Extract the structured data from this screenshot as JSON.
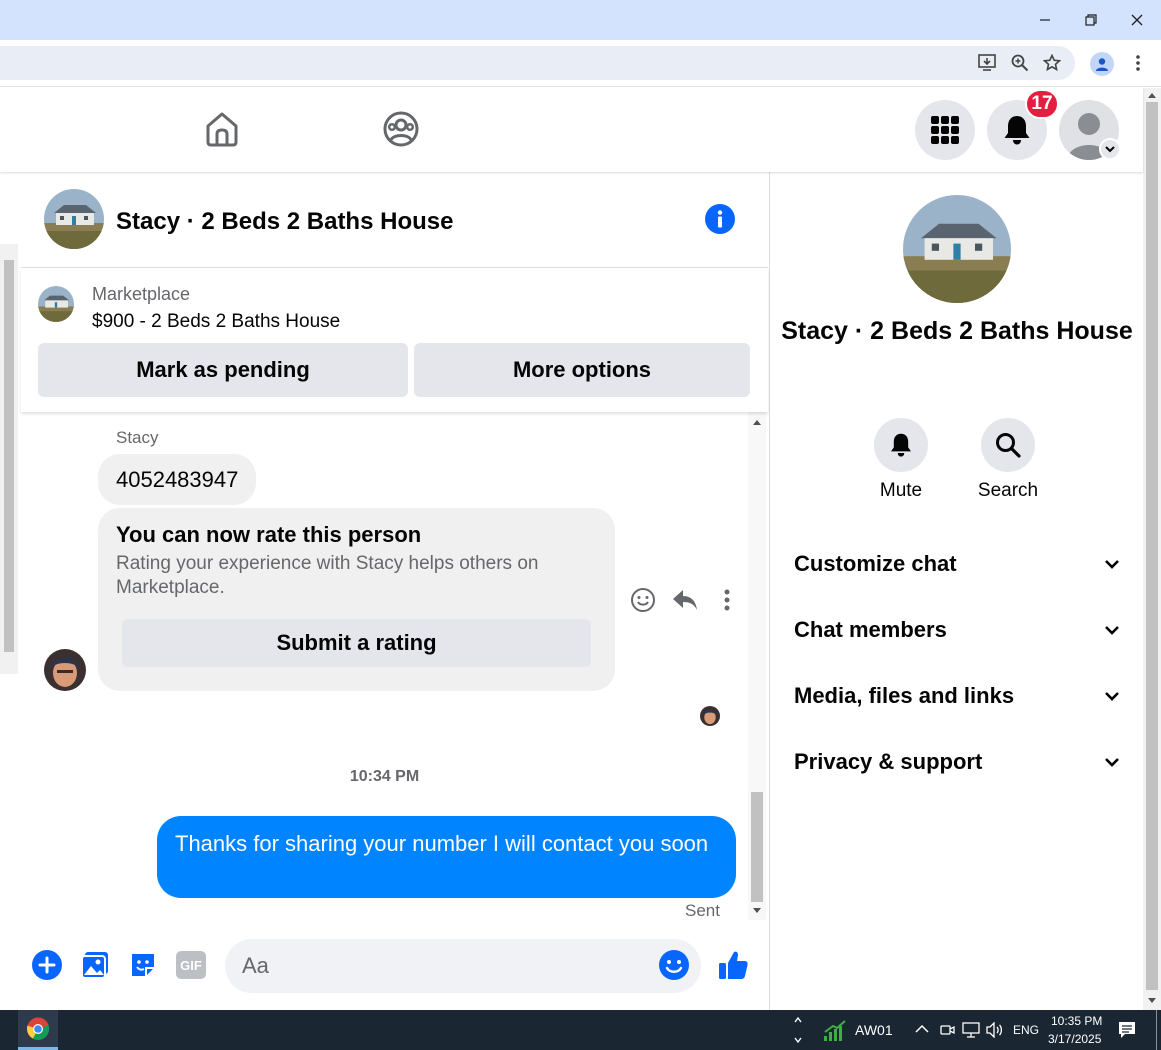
{
  "browser": {
    "window_controls": {
      "minimize": "—",
      "restore": "❐",
      "close": "✕"
    }
  },
  "nav": {
    "notification_count": "17"
  },
  "chat": {
    "title": "Stacy · 2 Beds 2 Baths House"
  },
  "marketplace": {
    "label": "Marketplace",
    "listing": "$900 - 2 Beds 2 Baths House",
    "pending_button": "Mark as pending",
    "more_button": "More options"
  },
  "messages": {
    "sender": "Stacy",
    "phone_message": "4052483947",
    "rating_title": "You can now rate this person",
    "rating_text": "Rating your experience with Stacy helps others on Marketplace.",
    "rating_button": "Submit a rating",
    "time": "10:34 PM",
    "outgoing": "Thanks for sharing your number I will contact you soon",
    "sent_status": "Sent"
  },
  "composer": {
    "placeholder": "Aa",
    "gif_label": "GIF"
  },
  "right_panel": {
    "title": "Stacy · 2 Beds 2 Baths House",
    "mute_label": "Mute",
    "search_label": "Search",
    "sections": [
      "Customize chat",
      "Chat members",
      "Media, files and links",
      "Privacy & support"
    ]
  },
  "taskbar": {
    "stock": "AW01",
    "language": "ENG",
    "time": "10:35 PM",
    "date": "3/17/2025"
  },
  "colors": {
    "messenger_blue": "#0084ff",
    "badge_red": "#e41e3f",
    "titlebar": "#d3e3fd"
  }
}
